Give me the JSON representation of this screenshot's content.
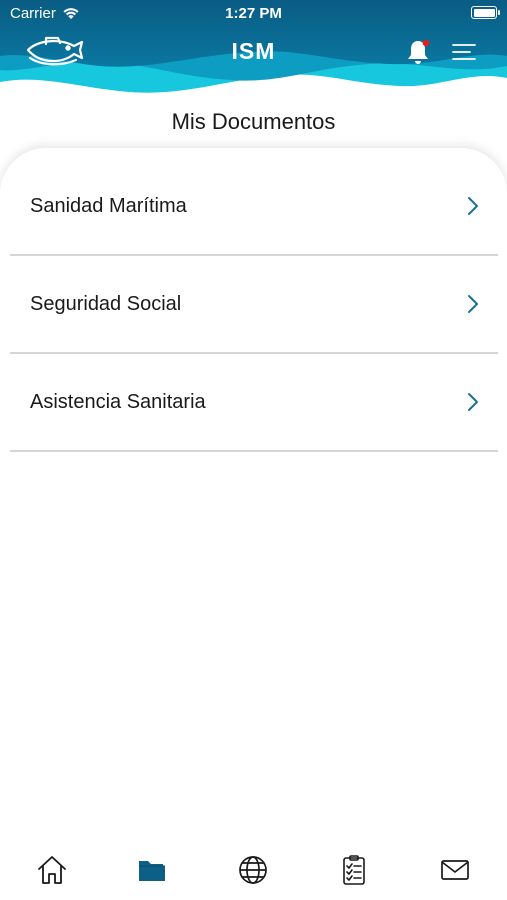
{
  "status_bar": {
    "carrier": "Carrier",
    "time": "1:27 PM"
  },
  "nav": {
    "title": "ISM",
    "logo_icon": "ship-fish-logo-icon",
    "bell_icon": "bell-icon",
    "menu_icon": "menu-icon",
    "notification_dot_color": "#e02020"
  },
  "page": {
    "title": "Mis Documentos"
  },
  "documents": {
    "items": [
      {
        "label": "Sanidad Marítima",
        "icon": "chevron-right-icon"
      },
      {
        "label": "Seguridad Social",
        "icon": "chevron-right-icon"
      },
      {
        "label": "Asistencia Sanitaria",
        "icon": "chevron-right-icon"
      }
    ]
  },
  "tab_bar": {
    "items": [
      {
        "icon": "home-icon",
        "active": false
      },
      {
        "icon": "folder-icon",
        "active": true
      },
      {
        "icon": "globe-icon",
        "active": false
      },
      {
        "icon": "checklist-icon",
        "active": false
      },
      {
        "icon": "mail-icon",
        "active": false
      }
    ]
  },
  "colors": {
    "header_dark": "#0a5a80",
    "header_mid": "#0f8fb5",
    "header_light": "#22d0e6",
    "accent": "#0d5f86",
    "chevron": "#1e6e95"
  }
}
